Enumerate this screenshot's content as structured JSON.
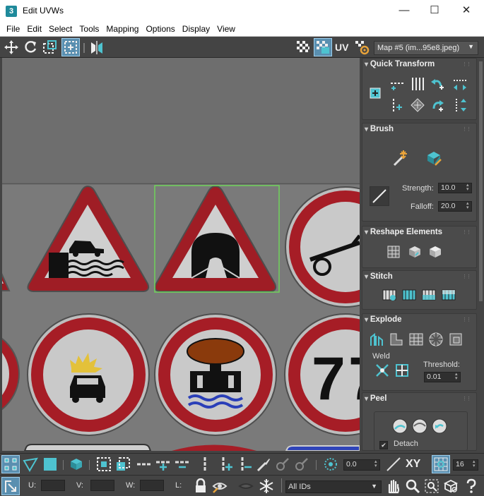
{
  "window": {
    "title": "Edit UVWs",
    "app_icon_text": "3",
    "minimize": "—",
    "maximize": "☐",
    "close": "✕"
  },
  "menu": [
    "File",
    "Edit",
    "Select",
    "Tools",
    "Mapping",
    "Options",
    "Display",
    "View"
  ],
  "toolbar": {
    "uv_label": "UV",
    "map_select": "Map #5 (im...95e8.jpeg)"
  },
  "panel": {
    "quick_transform": "Quick Transform",
    "brush": "Brush",
    "strength_label": "Strength:",
    "strength_value": "10.0",
    "falloff_label": "Falloff:",
    "falloff_value": "20.0",
    "reshape_elements": "Reshape Elements",
    "stitch": "Stitch",
    "explode": "Explode",
    "weld_label": "Weld",
    "threshold_label": "Threshold:",
    "threshold_value": "0.01",
    "peel": "Peel",
    "detach_label": "Detach",
    "detach_checked": true
  },
  "bottom": {
    "offset_value": "0.0",
    "xy_label": "XY",
    "grid_value": "16",
    "u_label": "U:",
    "v_label": "V:",
    "w_label": "W:",
    "l_label": "L:",
    "ids_select": "All IDs"
  },
  "viewport": {
    "sign_number_text": "7"
  },
  "colors": {
    "accent": "#4ec3d0",
    "selection": "#6fd35a",
    "sign_red": "#b81c26"
  }
}
